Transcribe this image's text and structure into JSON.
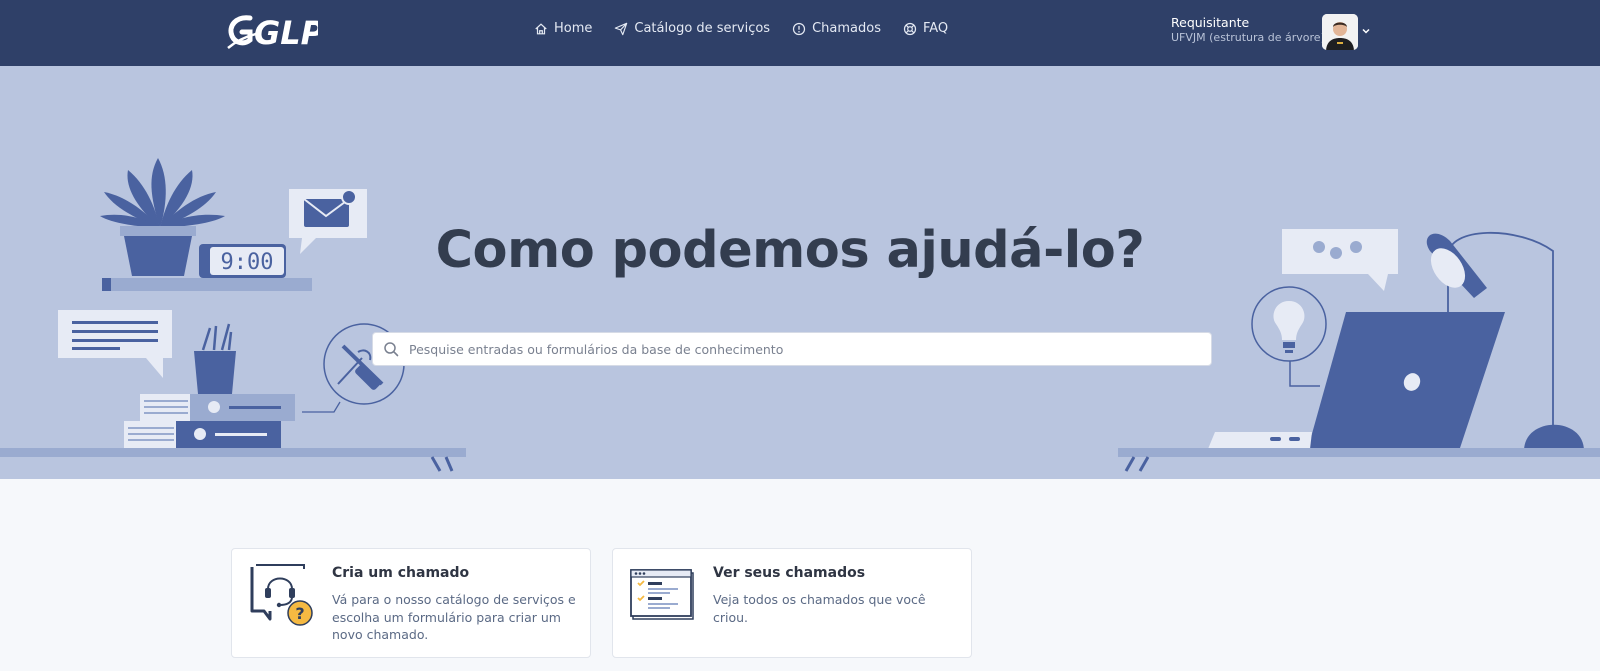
{
  "app": {
    "logo_text": "GLPI"
  },
  "nav": {
    "items": [
      {
        "label": "Home",
        "icon": "home-icon"
      },
      {
        "label": "Catálogo de serviços",
        "icon": "paper-plane-icon"
      },
      {
        "label": "Chamados",
        "icon": "alert-circle-icon"
      },
      {
        "label": "FAQ",
        "icon": "lifebuoy-icon"
      }
    ]
  },
  "user": {
    "name": "Requisitante",
    "entity": "UFVJM (estrutura de árvore)"
  },
  "hero": {
    "title": "Como podemos ajudá-lo?",
    "clock": "9:00",
    "search_placeholder": "Pesquise entradas ou formulários da base de conhecimento"
  },
  "cards": [
    {
      "title": "Cria um chamado",
      "description": "Vá para o nosso catálogo de serviços e escolha um formulário para criar um novo chamado.",
      "icon": "headset-help-icon"
    },
    {
      "title": "Ver seus chamados",
      "description": "Veja todos os chamados que você criou.",
      "icon": "ticket-list-icon"
    }
  ],
  "colors": {
    "topbar": "#2f4068",
    "hero_bg": "#b9c5df",
    "illustration": "#4a62a0",
    "page_bg": "#f6f8fb"
  }
}
